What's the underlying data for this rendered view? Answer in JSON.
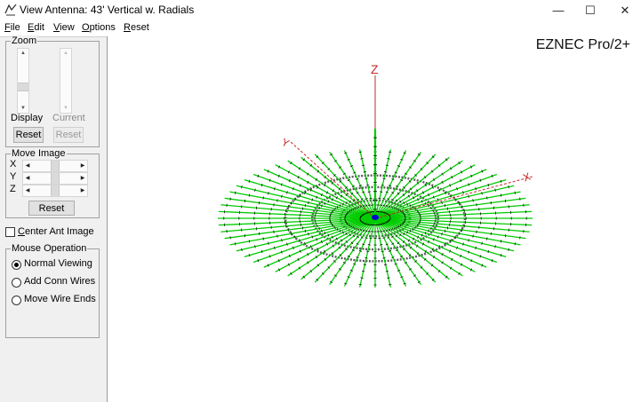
{
  "window": {
    "title": "View Antenna: 43' Vertical w. Radials",
    "minimize_glyph": "—",
    "maximize_glyph": "☐",
    "close_glyph": "✕"
  },
  "menu": [
    {
      "label": "File",
      "shortcut_index": 0
    },
    {
      "label": "Edit",
      "shortcut_index": 0
    },
    {
      "label": "View",
      "shortcut_index": 0
    },
    {
      "label": "Options",
      "shortcut_index": 0
    },
    {
      "label": "Reset",
      "shortcut_index": 0
    }
  ],
  "zoom": {
    "group_title": "Zoom",
    "display_label": "Display",
    "current_label": "Current",
    "display_reset": "Reset",
    "current_reset": "Reset",
    "display_level": 0.55,
    "current_level": 0.0
  },
  "move_image": {
    "group_title": "Move Image",
    "axes": [
      {
        "letter": "X",
        "level": 0.5
      },
      {
        "letter": "Y",
        "level": 0.5
      },
      {
        "letter": "Z",
        "level": 0.5
      }
    ],
    "reset": "Reset"
  },
  "center_ant": {
    "label": "Center Ant Image",
    "checked": false
  },
  "mouse_operation": {
    "group_title": "Mouse Operation",
    "options": [
      {
        "label": "Normal Viewing",
        "selected": true
      },
      {
        "label": "Add Conn Wires",
        "selected": false
      },
      {
        "label": "Move Wire Ends",
        "selected": false
      }
    ]
  },
  "view": {
    "brand": "EZNEC Pro/2+",
    "axes": {
      "x": "X",
      "y": "Y",
      "z": "Z"
    },
    "radial_count": 64,
    "colors": {
      "wire": "#00cc00",
      "axis": "#c42b2b",
      "segment_marks": "#000000",
      "source": "#0000cc",
      "ground_ring": "#5a5a5a"
    }
  }
}
